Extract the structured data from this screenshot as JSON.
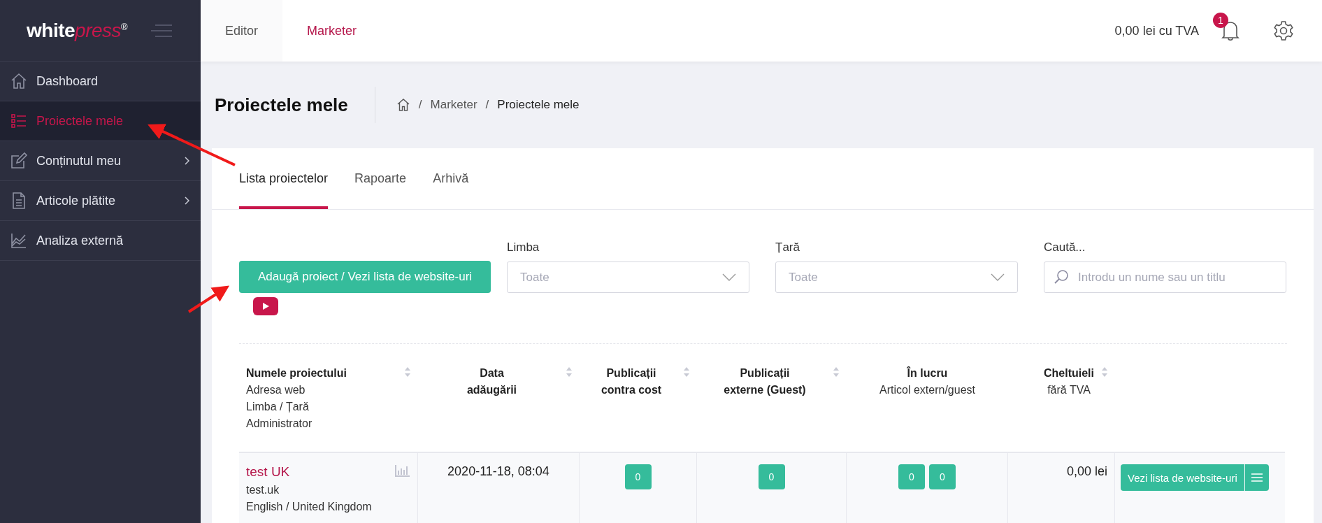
{
  "sidebar": {
    "logo": {
      "main": "white",
      "accent": "press",
      "mark": "®"
    },
    "items": [
      {
        "label": "Dashboard",
        "kind": "home",
        "selected": false,
        "has_submenu": false
      },
      {
        "label": "Proiectele mele",
        "kind": "list",
        "selected": true,
        "has_submenu": false
      },
      {
        "label": "Conținutul meu",
        "kind": "edit",
        "selected": false,
        "has_submenu": true
      },
      {
        "label": "Articole plătite",
        "kind": "document",
        "selected": false,
        "has_submenu": true
      },
      {
        "label": "Analiza externă",
        "kind": "chart",
        "selected": false,
        "has_submenu": false
      }
    ]
  },
  "topbar": {
    "tabs": [
      {
        "label": "Editor",
        "selected": false
      },
      {
        "label": "Marketer",
        "selected": true
      }
    ],
    "balance": "0,00 lei cu TVA",
    "notifications": "1"
  },
  "page": {
    "title": "Proiectele mele",
    "breadcrumb": {
      "separator": "/",
      "items": [
        "Marketer",
        "Proiectele mele"
      ]
    }
  },
  "tabs": [
    {
      "label": "Lista proiectelor",
      "selected": true
    },
    {
      "label": "Rapoarte",
      "selected": false
    },
    {
      "label": "Arhivă",
      "selected": false
    }
  ],
  "add_button": "Adaugă proiect / Vezi lista de website-uri",
  "filters": [
    {
      "kind": "select",
      "label": "Limba",
      "placeholder": "Toate"
    },
    {
      "kind": "select",
      "label": "Țară",
      "placeholder": "Toate"
    },
    {
      "kind": "search",
      "label": "Caută...",
      "placeholder": "Introdu un nume sau un titlu"
    }
  ],
  "table": {
    "columns": [
      {
        "title": [
          "Numele proiectului"
        ],
        "subtitle": [
          "Adresa web",
          "Limba / Țară",
          "Administrator"
        ],
        "sortable": true
      },
      {
        "title": [
          "Data",
          "adăugării"
        ],
        "sortable": true
      },
      {
        "title": [
          "Publicații",
          "contra cost"
        ],
        "sortable": true
      },
      {
        "title": [
          "Publicații",
          "externe (Guest)"
        ],
        "sortable": true
      },
      {
        "title": [
          "În lucru"
        ],
        "subtitle": [
          "Articol extern/guest"
        ],
        "sortable": false
      },
      {
        "title": [
          "Cheltuieli"
        ],
        "subtitle": [
          "fără TVA"
        ],
        "sortable": true
      }
    ],
    "rows": [
      {
        "name": "test UK",
        "address": "test.uk",
        "language_country": "English / United Kingdom",
        "date": "2020-11-18, 08:04",
        "paid": [
          "0"
        ],
        "guest": [
          "0"
        ],
        "in_progress": [
          "0",
          "0"
        ],
        "spend": "0,00 lei",
        "action": "Vezi lista de website-uri"
      }
    ]
  }
}
